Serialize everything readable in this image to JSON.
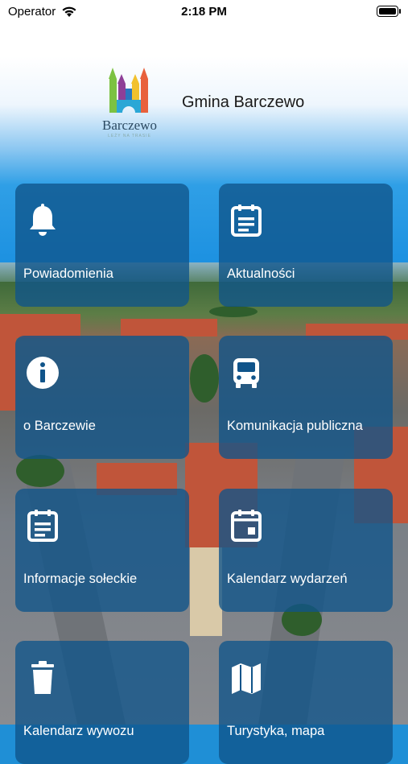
{
  "status_bar": {
    "carrier": "Operator",
    "time": "2:18 PM"
  },
  "header": {
    "logo_text": "Barczewo",
    "logo_subtext": "LEŻY NA TRASIE",
    "title": "Gmina Barczewo"
  },
  "tiles": [
    {
      "label": "Powiadomienia",
      "icon": "bell-icon"
    },
    {
      "label": "Aktualności",
      "icon": "news-icon"
    },
    {
      "label": "o Barczewie",
      "icon": "info-icon"
    },
    {
      "label": "Komunikacja publiczna",
      "icon": "bus-icon"
    },
    {
      "label": "Informacje sołeckie",
      "icon": "document-icon"
    },
    {
      "label": "Kalendarz wydarzeń",
      "icon": "calendar-icon"
    },
    {
      "label": "Kalendarz wywozu",
      "icon": "trash-icon"
    },
    {
      "label": "Turystyka, mapa",
      "icon": "map-icon"
    }
  ],
  "colors": {
    "tile_bg": "#10548a",
    "sky": "#1a8fe0"
  }
}
